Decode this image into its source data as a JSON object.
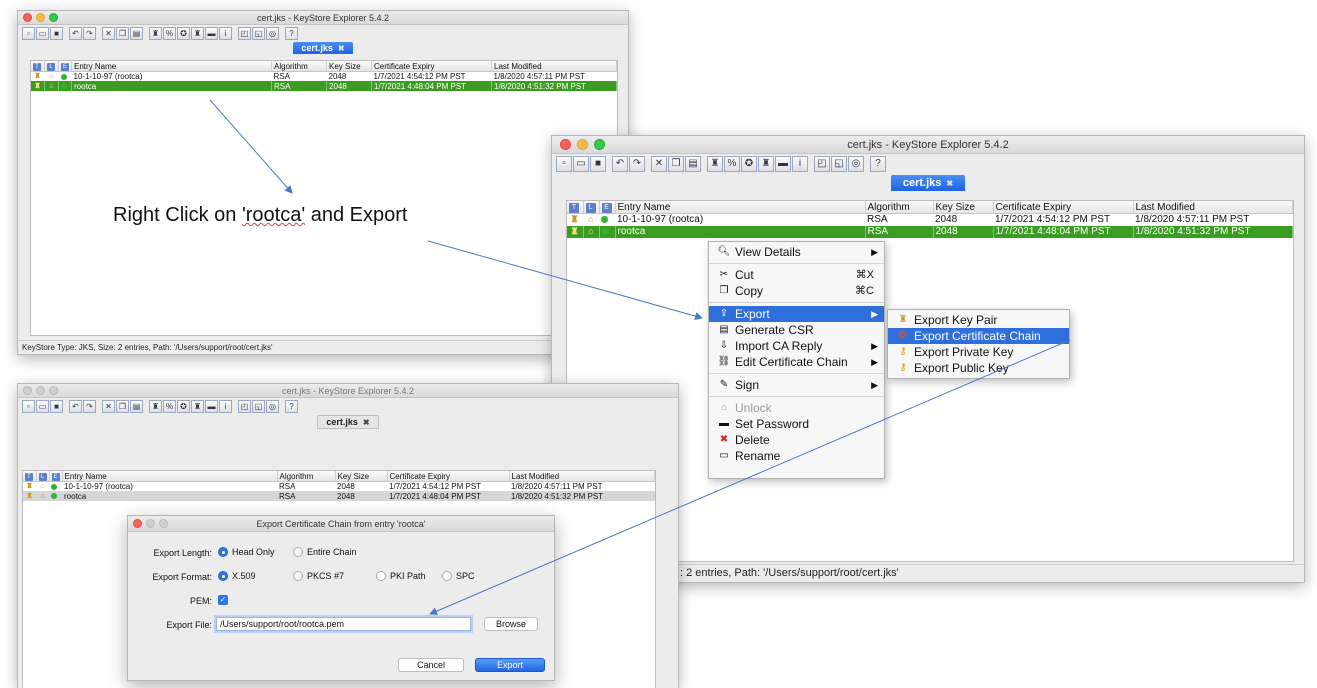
{
  "app_title": "cert.jks - KeyStore Explorer 5.4.2",
  "tab_label": "cert.jks",
  "columns": [
    "T",
    "L",
    "E",
    "Entry Name",
    "Algorithm",
    "Key Size",
    "Certificate Expiry",
    "Last Modified"
  ],
  "entries": [
    {
      "name": "10-1-10-97 (rootca)",
      "algorithm": "RSA",
      "key_size": "2048",
      "expiry": "1/7/2021 4:54:12 PM PST",
      "modified": "1/8/2020 4:57:11 PM PST"
    },
    {
      "name": "rootca",
      "algorithm": "RSA",
      "key_size": "2048",
      "expiry": "1/7/2021 4:48:04 PM PST",
      "modified": "1/8/2020 4:51:32 PM PST"
    }
  ],
  "status_text": "KeyStore Type: JKS, Size: 2 entries, Path: '/Users/support/root/cert.jks'",
  "status_text_partial": ": 2 entries, Path: '/Users/support/root/cert.jks'",
  "annotation": {
    "prefix": "Right Click on ",
    "quoted": "'rootca'",
    "suffix": " and Export"
  },
  "context_menu": {
    "view_details": "View Details",
    "cut": "Cut",
    "cut_shortcut": "⌘X",
    "copy": "Copy",
    "copy_shortcut": "⌘C",
    "export": "Export",
    "generate_csr": "Generate CSR",
    "import_ca_reply": "Import CA Reply",
    "edit_cert_chain": "Edit Certificate Chain",
    "sign": "Sign",
    "unlock": "Unlock",
    "set_password": "Set Password",
    "delete": "Delete",
    "rename": "Rename"
  },
  "export_submenu": {
    "key_pair": "Export Key Pair",
    "cert_chain": "Export Certificate Chain",
    "private_key": "Export Private Key",
    "public_key": "Export Public Key"
  },
  "dialog": {
    "title": "Export Certificate Chain from entry 'rootca'",
    "length_label": "Export Length:",
    "length_head": "Head Only",
    "length_entire": "Entire Chain",
    "format_label": "Export Format:",
    "format_x509": "X.509",
    "format_pkcs7": "PKCS #7",
    "format_pkipath": "PKI Path",
    "format_spc": "SPC",
    "pem_label": "PEM:",
    "file_label": "Export File:",
    "file_value": "/Users/support/root/rootca.pem",
    "browse": "Browse",
    "cancel": "Cancel",
    "export": "Export"
  },
  "colors": {
    "selection_green": "#3b9c23",
    "highlight_blue": "#2f6fdc",
    "arrow": "#4a78c8"
  }
}
